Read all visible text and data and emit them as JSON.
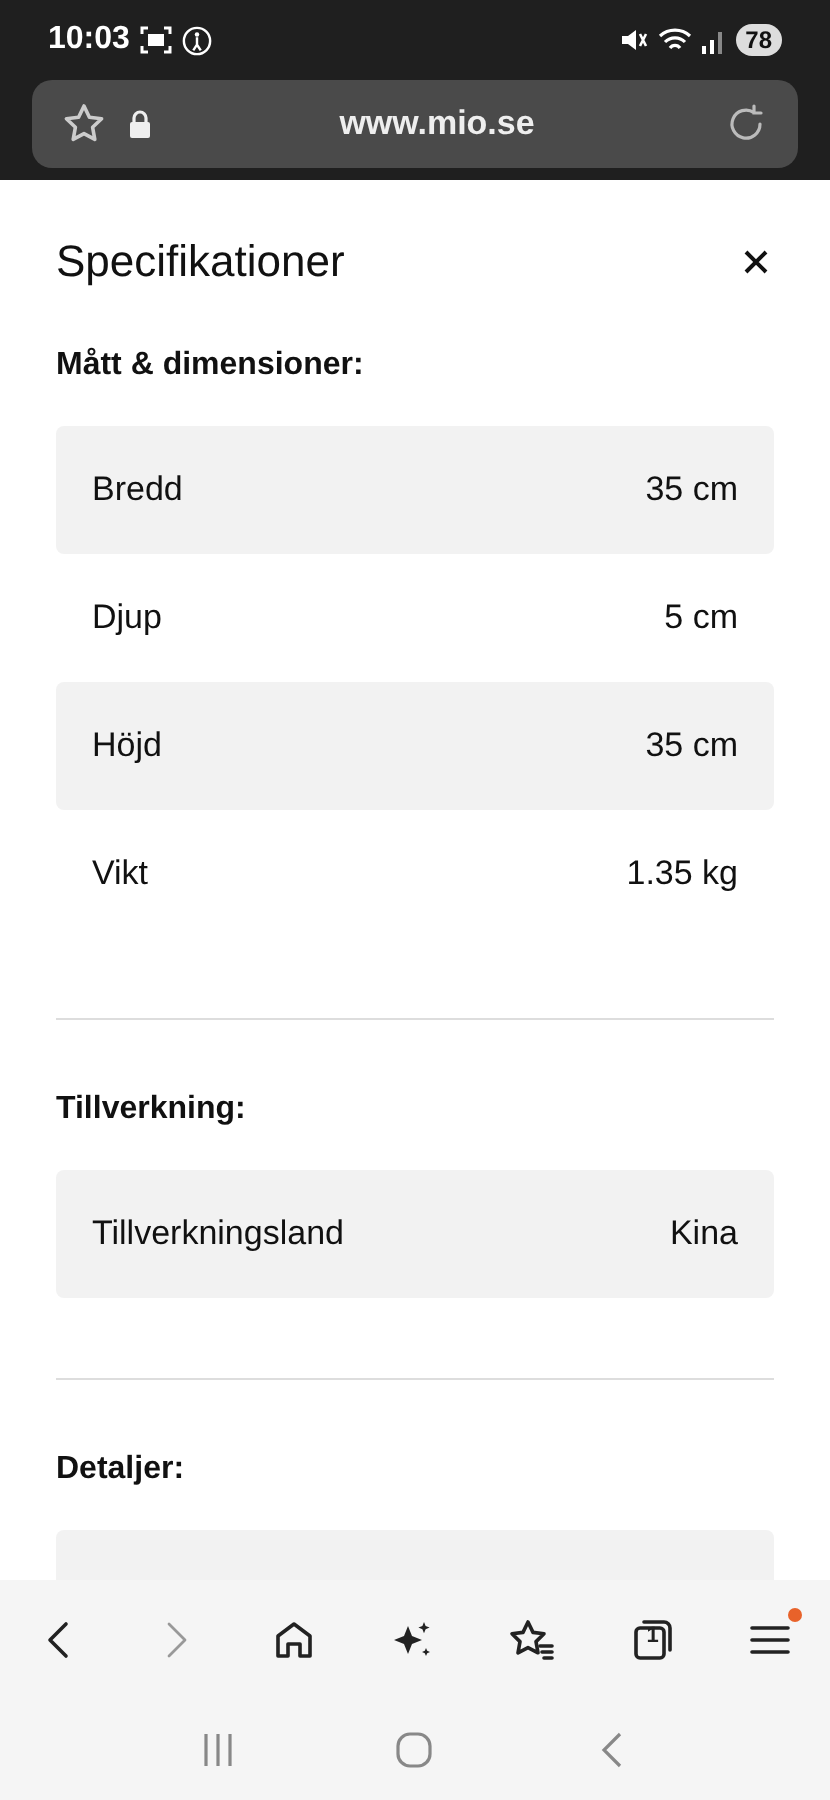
{
  "status_bar": {
    "time": "10:03",
    "battery": "78"
  },
  "address_bar": {
    "url": "www.mio.se"
  },
  "panel": {
    "title": "Specifikationer",
    "sections": [
      {
        "heading": "Mått & dimensioner:",
        "rows": [
          {
            "label": "Bredd",
            "value": "35 cm"
          },
          {
            "label": "Djup",
            "value": "5 cm"
          },
          {
            "label": "Höjd",
            "value": "35 cm"
          },
          {
            "label": "Vikt",
            "value": "1.35 kg"
          }
        ]
      },
      {
        "heading": "Tillverkning:",
        "rows": [
          {
            "label": "Tillverkningsland",
            "value": "Kina"
          }
        ]
      },
      {
        "heading": "Detaljer:"
      }
    ]
  },
  "toolbar": {
    "back_disabled": false,
    "forward_disabled": true,
    "tab_count": "1",
    "menu_badge": true
  }
}
